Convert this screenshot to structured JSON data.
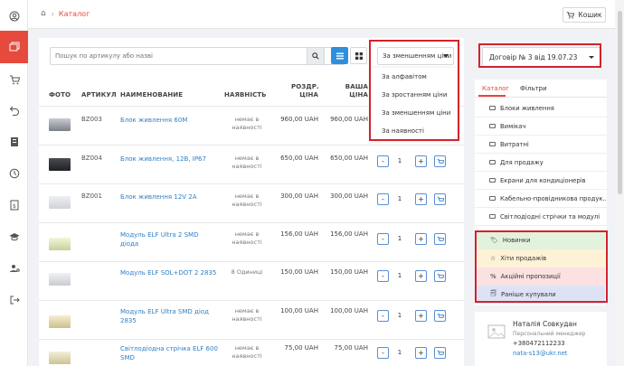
{
  "topbar": {
    "breadcrumb": "Каталог",
    "cart_label": "Кошик"
  },
  "search": {
    "placeholder": "Пошук по артикулу або назві"
  },
  "sort": {
    "selected": "За зменшенням ціни",
    "options": [
      "За алфавітом",
      "За зростанням ціни",
      "За зменшенням ціни",
      "За наявності"
    ]
  },
  "table": {
    "headers": {
      "photo": "ФОТО",
      "article": "АРТИКУЛ",
      "name": "НАИМЕНОВАНИЕ",
      "avail": "НАЯВНІСТЬ",
      "retail_1": "РОЗДР.",
      "retail_2": "ЦІНА",
      "price_1": "ВАША",
      "price_2": "ЦІНА"
    },
    "rows": [
      {
        "article": "BZ003",
        "name": "Блок живлення 60М",
        "availability": "немає в наявності",
        "retail": "960,00 UAH",
        "price": "960,00 UAH",
        "qty": ""
      },
      {
        "article": "BZ004",
        "name": "Блок живлення, 12В, IP67",
        "availability": "немає в наявності",
        "retail": "650,00 UAH",
        "price": "650,00 UAH",
        "qty": "1"
      },
      {
        "article": "BZ001",
        "name": "Блок живлення 12V 2A",
        "availability": "немає в наявності",
        "retail": "300,00 UAH",
        "price": "300,00 UAH",
        "qty": "1"
      },
      {
        "article": "",
        "name": "Модуль ELF Ultra 2 SMD діода",
        "availability": "немає в наявності",
        "retail": "156,00 UAH",
        "price": "156,00 UAH",
        "qty": "1"
      },
      {
        "article": "",
        "name": "Модуль ELF SOL+DOT 2 2835",
        "availability": "8 Одиниці",
        "retail": "150,00 UAH",
        "price": "150,00 UAH",
        "qty": "1"
      },
      {
        "article": "",
        "name": "Модуль ELF Ultra SMD діод 2835",
        "availability": "немає в наявності",
        "retail": "100,00 UAH",
        "price": "100,00 UAH",
        "qty": "1"
      },
      {
        "article": "",
        "name": "Світлодіодна стрічка ELF 600 SMD",
        "availability": "немає в наявності",
        "retail": "75,00 UAH",
        "price": "75,00 UAH",
        "qty": "1"
      }
    ]
  },
  "contract": {
    "label": "Договір № 3 від 19.07.23"
  },
  "sidebar": {
    "tabs": [
      "Каталог",
      "Фільтри"
    ],
    "categories": [
      "Блоки живлення",
      "Вимікач",
      "Витратні",
      "Для продажу",
      "Екрани для кондиціонерів",
      "Кабельно-провідникова продук...",
      "Світлодіодні стрічки та модулі"
    ],
    "promo": [
      {
        "icon": "🏷",
        "label": "Новинки",
        "color": "#e2f2dc"
      },
      {
        "icon": "☆",
        "label": "Хіти продажів",
        "color": "#fdf1d6"
      },
      {
        "icon": "%",
        "label": "Акційні пропозиції",
        "color": "#fbe1e1"
      },
      {
        "icon": "🗐",
        "label": "Раніше купували",
        "color": "#dde3f5"
      }
    ]
  },
  "manager": {
    "name": "Наталія Совкудан",
    "role": "Персональний менеджер",
    "phone": "+380472112233",
    "email": "nata-s13@ukr.net"
  }
}
